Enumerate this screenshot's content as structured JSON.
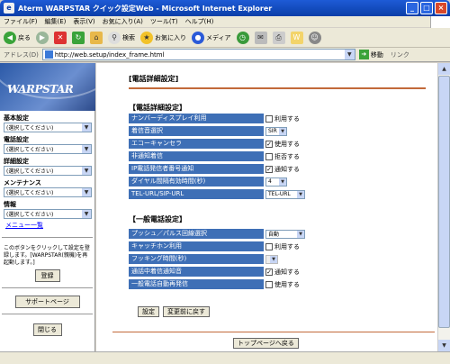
{
  "window": {
    "title": "Aterm WARPSTAR クイック設定Web - Microsoft Internet Explorer"
  },
  "menu": [
    "ファイル(F)",
    "編集(E)",
    "表示(V)",
    "お気に入り(A)",
    "ツール(T)",
    "ヘルプ(H)"
  ],
  "toolbar": {
    "back": "戻る",
    "search": "検索",
    "favorites": "お気に入り",
    "media": "メディア"
  },
  "address": {
    "label": "アドレス(D)",
    "url": "http://web.setup/index_frame.html",
    "go": "移動",
    "links": "リンク"
  },
  "sidebar": {
    "logo": "WARPSTAR",
    "sections": [
      {
        "label": "基本設定",
        "value": "(選択してください)"
      },
      {
        "label": "電話設定",
        "value": "(選択してください)"
      },
      {
        "label": "詳細設定",
        "value": "(選択してください)"
      },
      {
        "label": "メンテナンス",
        "value": "(選択してください)"
      },
      {
        "label": "情報",
        "value": "(選択してください)"
      }
    ],
    "menu_list": "メニュー一覧",
    "note": "このボタンをクリックして設定を登録します。[WARPSTAR(親機)を再起動します。]",
    "register": "登録",
    "support": "サポートページ",
    "close": "閉じる"
  },
  "main": {
    "page_title": "[電話詳細設定]",
    "phone_section": "【電話詳細設定】",
    "phone_rows": [
      {
        "label": "ナンバーディスプレイ利用",
        "type": "checkbox",
        "checked": false,
        "text": "利用する"
      },
      {
        "label": "着信音選択",
        "type": "select",
        "value": "SIR"
      },
      {
        "label": "エコーキャンセラ",
        "type": "checkbox",
        "checked": true,
        "text": "使用する"
      },
      {
        "label": "非通知着信",
        "type": "checkbox",
        "checked": false,
        "text": "拒否する"
      },
      {
        "label": "IP電話発信者番号通知",
        "type": "checkbox",
        "checked": true,
        "text": "通知する"
      },
      {
        "label": "ダイヤル間隔有効時間(秒)",
        "type": "select",
        "value": "4"
      },
      {
        "label": "TEL-URL/SIP-URL",
        "type": "select",
        "value": "TEL-URL"
      }
    ],
    "general_section": "【一般電話設定】",
    "general_rows": [
      {
        "label": "プッシュ／パルス回線選択",
        "type": "select",
        "value": "自動"
      },
      {
        "label": "キャッチホン利用",
        "type": "checkbox",
        "checked": false,
        "text": "利用する"
      },
      {
        "label": "フッキング時間(秒)",
        "type": "select-disabled",
        "value": ""
      },
      {
        "label": "通話中着信通知音",
        "type": "checkbox",
        "checked": true,
        "text": "通知する"
      },
      {
        "label": "一般電話自動再発信",
        "type": "checkbox",
        "checked": false,
        "text": "使用する"
      }
    ],
    "set_button": "設定",
    "revert_button": "変更前に戻す",
    "top_button": "トップページへ戻る"
  },
  "colors": {
    "label_bg": "#3e6fb6",
    "rule": "#c26a3a"
  }
}
